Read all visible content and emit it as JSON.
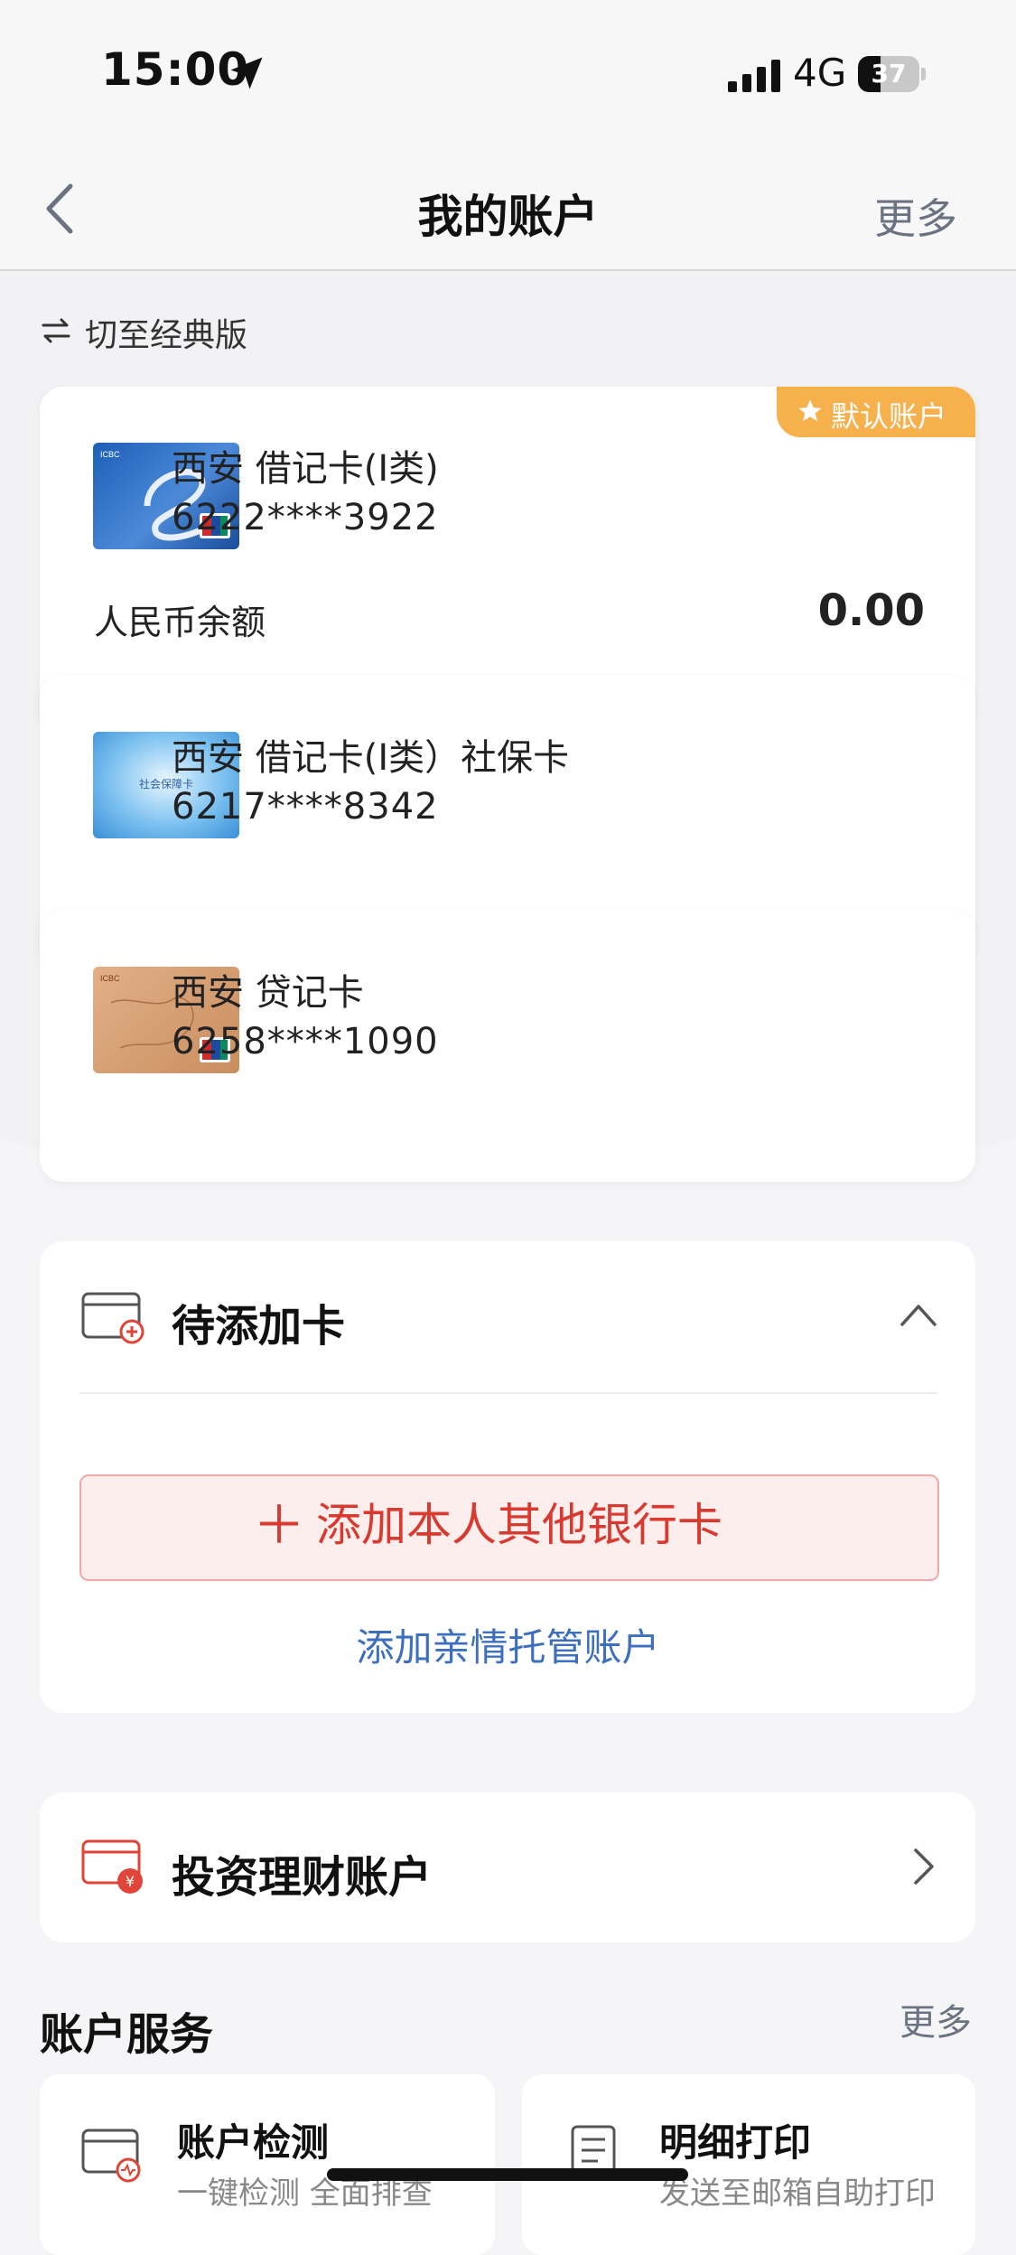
{
  "status_bar": {
    "time": "15:00",
    "network": "4G",
    "battery": "37",
    "battery_level": 0.37
  },
  "nav": {
    "title": "我的账户",
    "more": "更多"
  },
  "switch_label": "切至经典版",
  "cards": [
    {
      "title": "西安 借记卡(Ⅰ类)",
      "number": "6222****3922",
      "badge": "默认账户",
      "balance_label": "人民币余额",
      "balance": "0.00"
    },
    {
      "title": "西安 借记卡(Ⅰ类）社保卡",
      "number": "6217****8342"
    },
    {
      "title": "西安 贷记卡",
      "number": "6258****1090"
    }
  ],
  "pending": {
    "title": "待添加卡",
    "add_button": "添加本人其他银行卡",
    "family_link": "添加亲情托管账户"
  },
  "investment": {
    "title": "投资理财账户"
  },
  "services": {
    "title": "账户服务",
    "more": "更多",
    "items": [
      {
        "title": "账户检测",
        "subtitle": "一键检测 全面排查"
      },
      {
        "title": "明细打印",
        "subtitle": "发送至邮箱自助打印"
      }
    ]
  },
  "colors": {
    "accent_red": "#d93a30",
    "link_blue": "#3d6fbf",
    "badge_orange": "#f6b14d"
  }
}
